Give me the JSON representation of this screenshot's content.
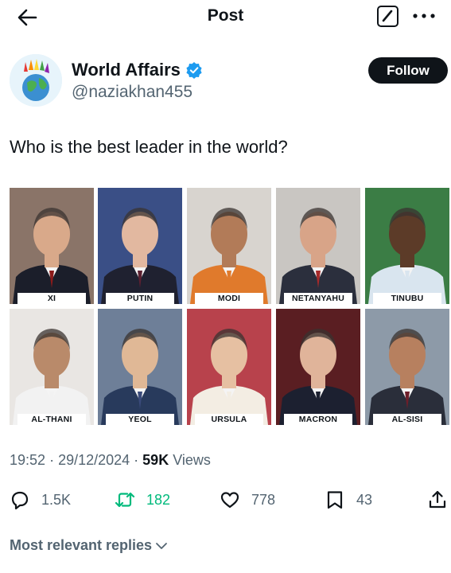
{
  "header": {
    "title": "Post"
  },
  "author": {
    "name": "World Affairs",
    "handle": "@naziakhan455",
    "follow_label": "Follow",
    "verified": true
  },
  "tweet": {
    "text": "Who is the best leader in the world?"
  },
  "media": {
    "leaders": [
      {
        "label": "XI",
        "bg": "#8a7468",
        "suit": "#1b1e2a",
        "skin": "#d9a98a",
        "tie": "#8b1a1a"
      },
      {
        "label": "PUTIN",
        "bg": "#3a4f86",
        "suit": "#1f2130",
        "skin": "#e2b8a0",
        "tie": "#5a2030"
      },
      {
        "label": "MODI",
        "bg": "#d8d4cf",
        "suit": "#e07a2c",
        "skin": "#b27b58",
        "tie": "#e07a2c"
      },
      {
        "label": "NETANYAHU",
        "bg": "#c9c6c2",
        "suit": "#2b2f3d",
        "skin": "#d8a488",
        "tie": "#a52a2a"
      },
      {
        "label": "TINUBU",
        "bg": "#3b7d45",
        "suit": "#d9e5ef",
        "skin": "#5c3b28",
        "tie": "#d9e5ef"
      },
      {
        "label": "AL-THANI",
        "bg": "#e9e6e3",
        "suit": "#f2f2f2",
        "skin": "#b98a6a",
        "tie": "#f2f2f2"
      },
      {
        "label": "YEOL",
        "bg": "#6e7f98",
        "suit": "#283a5c",
        "skin": "#e0b896",
        "tie": "#3a4a7a"
      },
      {
        "label": "URSULA",
        "bg": "#b8424c",
        "suit": "#f3ede3",
        "skin": "#e6c0a2",
        "tie": "#f3ede3"
      },
      {
        "label": "MACRON",
        "bg": "#5a1e22",
        "suit": "#1c2030",
        "skin": "#e0b49a",
        "tie": "#1c2030"
      },
      {
        "label": "AL-SISI",
        "bg": "#8d9aa8",
        "suit": "#2a2e3a",
        "skin": "#b7805f",
        "tie": "#6e1f2a"
      }
    ]
  },
  "meta": {
    "time": "19:52",
    "date": "29/12/2024",
    "views_count": "59K",
    "views_label": "Views"
  },
  "actions": {
    "replies": "1.5K",
    "retweets": "182",
    "likes": "778",
    "bookmarks": "43"
  },
  "replies_sort": {
    "label": "Most relevant replies"
  },
  "colors": {
    "verified": "#1d9bf0",
    "retweet": "#00ba7c",
    "secondary_text": "#536471"
  }
}
